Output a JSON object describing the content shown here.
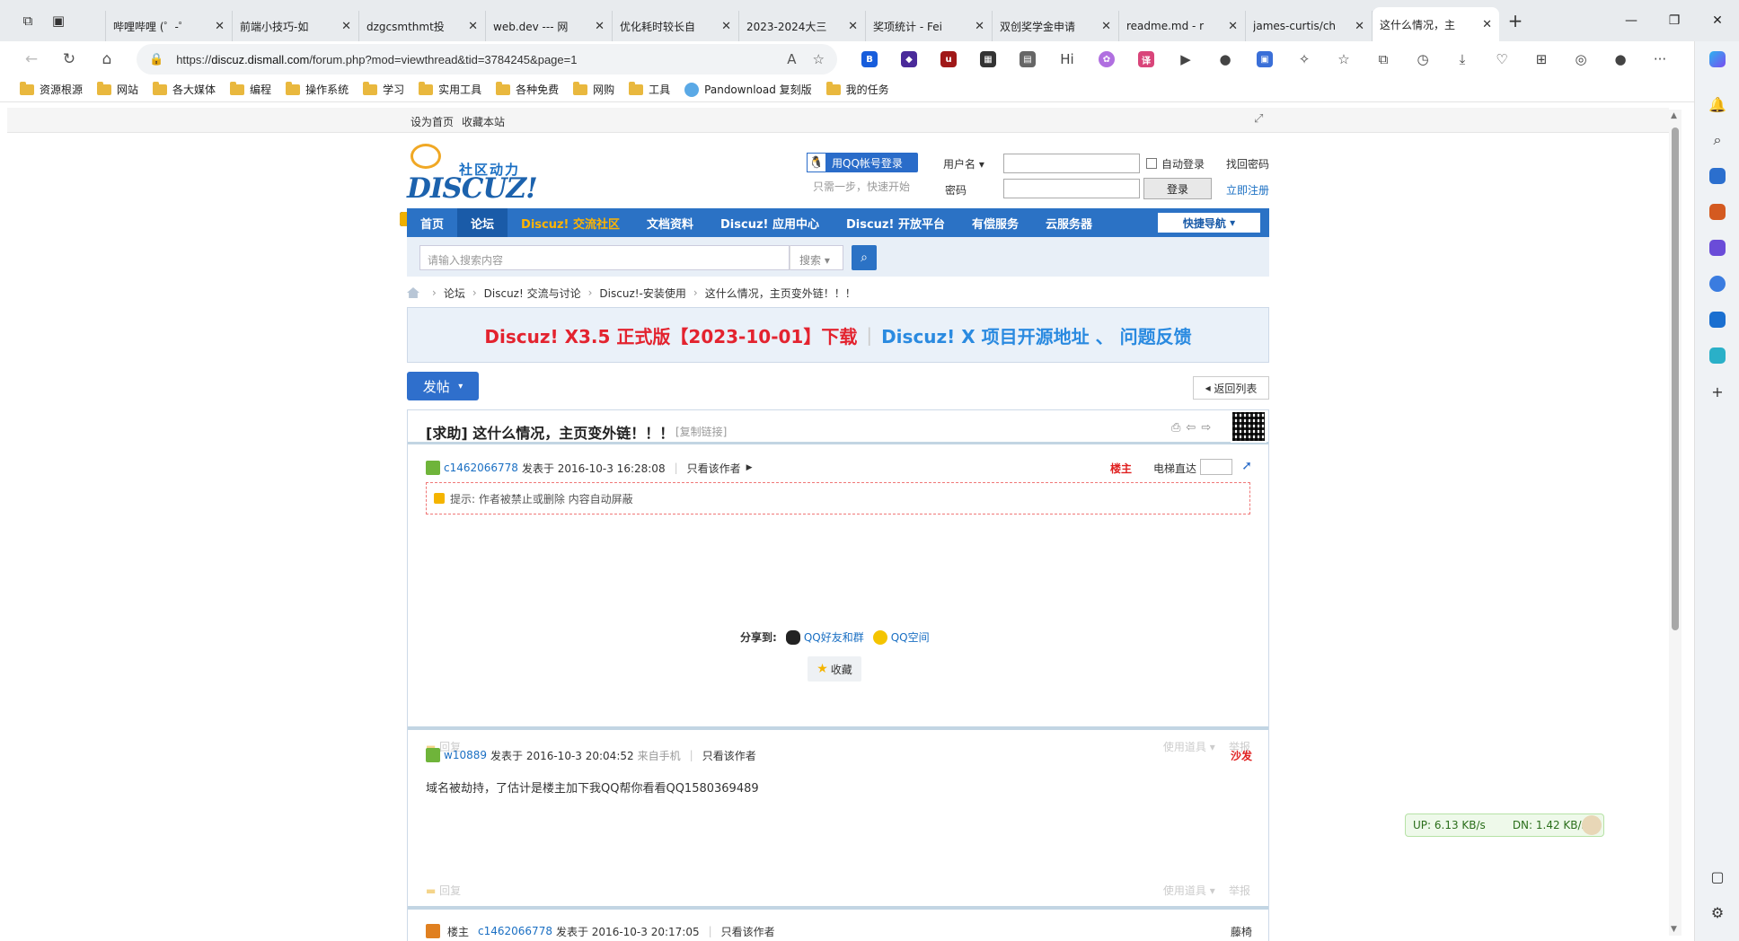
{
  "browser": {
    "tabs": [
      {
        "title": "",
        "color": "#4e6fb8"
      },
      {
        "title": "哔哩哔哩 (゜-゜",
        "color": "#4da3d8"
      },
      {
        "title": "前端小技巧-如",
        "color": "#4da3d8"
      },
      {
        "title": "dzgcsmthmt投",
        "color": "#4da3d8"
      },
      {
        "title": "web.dev --- 网",
        "color": "#3b5bdb"
      },
      {
        "title": "优化耗时较长自",
        "color": "#3b5bdb"
      },
      {
        "title": "2023-2024大三",
        "color": "#2b6fce"
      },
      {
        "title": "奖项统计 - Fei",
        "color": "#8b5cf6"
      },
      {
        "title": "双创奖学金申请",
        "color": "#2b5fd9"
      },
      {
        "title": "readme.md - r",
        "color": "#222222"
      },
      {
        "title": "james-curtis/ch",
        "color": "#222222"
      },
      {
        "title": "这什么情况，主",
        "color": "#f0b000",
        "active": true
      }
    ],
    "url_prefix": "https://",
    "url_domain": "discuz.dismall.com",
    "url_path": "/forum.php?mod=viewthread&tid=3784245&page=1",
    "bookmarks": [
      "资源根源",
      "网站",
      "各大媒体",
      "编程",
      "操作系统",
      "学习",
      "实用工具",
      "各种免费",
      "网购",
      "工具",
      "Pandownload 复刻版",
      "我的任务"
    ]
  },
  "page": {
    "topbar": {
      "set_home": "设为首页",
      "bookmark_site": "收藏本站"
    },
    "logo": {
      "slogan": "社区动力",
      "word": "DISCUZ!"
    },
    "login": {
      "qq_button": "用QQ帐号登录",
      "qq_hint": "只需一步，快速开始",
      "username_label": "用户名",
      "password_label": "密码",
      "auto_login": "自动登录",
      "find_password": "找回密码",
      "login_button": "登录",
      "register": "立即注册"
    },
    "nav": {
      "items": [
        "首页",
        "论坛",
        "Discuz! 交流社区",
        "文档资料",
        "Discuz! 应用中心",
        "Discuz! 开放平台",
        "有偿服务",
        "云服务器"
      ],
      "quick": "快捷导航"
    },
    "search": {
      "placeholder": "请输入搜索内容",
      "type": "搜索"
    },
    "breadcrumb": [
      "论坛",
      "Discuz! 交流与讨论",
      "Discuz!-安装使用",
      "这什么情况，主页变外链！！！"
    ],
    "banner": {
      "part1": "Discuz! X3.5 正式版【2023-10-01】下载",
      "part2": "Discuz! X 项目开源地址 、 问题反馈"
    },
    "post_button": "发帖",
    "back_to_list": "返回列表",
    "thread_title": "[求助] 这什么情况，主页变外链！！！",
    "copy_link": "[复制链接]",
    "posts": [
      {
        "author": "c1462066778",
        "posted": "发表于 2016-10-3 16:28:08",
        "only_author": "只看该作者",
        "floor": "楼主",
        "elevator": "电梯直达",
        "notice": "提示: 作者被禁止或删除 内容自动屏蔽",
        "share_label": "分享到:",
        "share_qq": "QQ好友和群",
        "share_qzone": "QQ空间",
        "favorite": "收藏",
        "reply": "回复",
        "tools": "使用道具",
        "report": "举报"
      },
      {
        "author": "w10889",
        "posted": "发表于 2016-10-3 20:04:52",
        "source": "来自手机",
        "only_author": "只看该作者",
        "floor": "沙发",
        "content": "域名被劫持，了估计是楼主加下我QQ帮你看看QQ1580369489",
        "reply": "回复",
        "tools": "使用道具",
        "report": "举报"
      },
      {
        "badge": "楼主",
        "author": "c1462066778",
        "posted": "发表于 2016-10-3 20:17:05",
        "only_author": "只看该作者",
        "floor": "藤椅"
      }
    ],
    "net_monitor": {
      "up": "UP: 6.13 KB/s",
      "down": "DN: 1.42 KB/s"
    }
  }
}
